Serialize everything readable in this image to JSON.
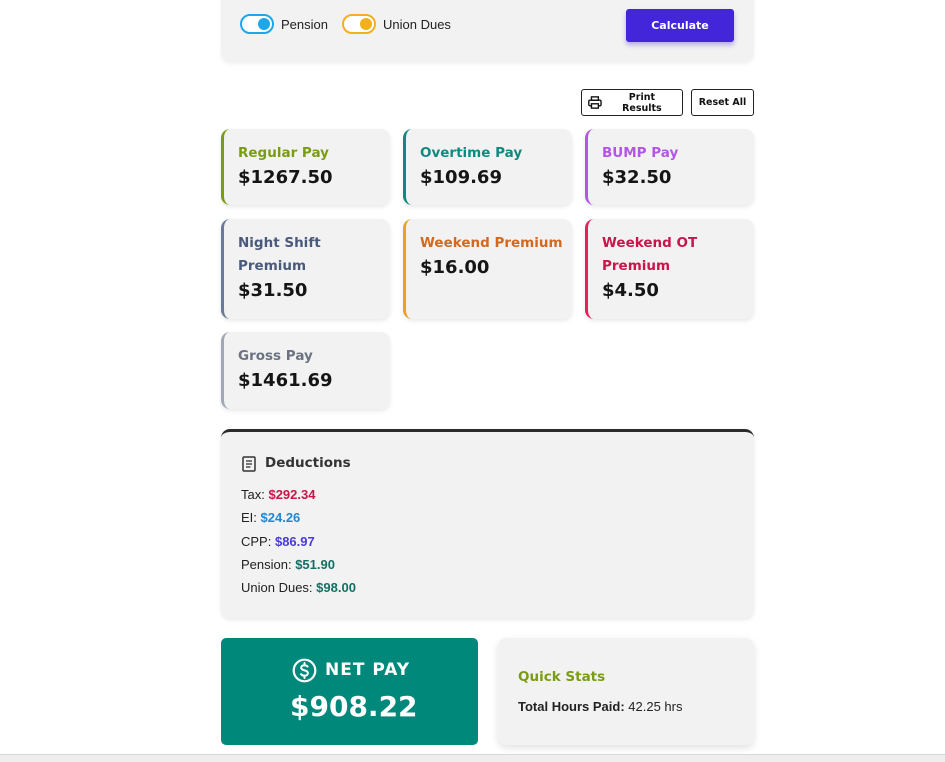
{
  "options": {
    "pension": {
      "label": "Pension",
      "color": "#1ea7e8",
      "on": true
    },
    "union_dues": {
      "label": "Union Dues",
      "color": "#f2b01e",
      "on": true
    }
  },
  "actions": {
    "calculate": "Calculate",
    "print": "Print Results",
    "reset": "Reset All"
  },
  "results": [
    {
      "label": "Regular Pay",
      "value": "$1267.50",
      "color": "#7a9c14"
    },
    {
      "label": "Overtime Pay",
      "value": "$109.69",
      "color": "#0f8a80"
    },
    {
      "label": "BUMP Pay",
      "value": "$32.50",
      "color": "#b455e8"
    },
    {
      "label": "Night Shift Premium",
      "value": "$31.50",
      "color": "#4a5a7a",
      "border": "#6a7a9a"
    },
    {
      "label": "Weekend Premium",
      "value": "$16.00",
      "color": "#d2691e",
      "border": "#f0a020"
    },
    {
      "label": "Weekend OT Premium",
      "value": "$4.50",
      "color": "#c8154a",
      "border": "#e8205a"
    },
    {
      "label": "Gross Pay",
      "value": "$1461.69",
      "color": "#6b7280",
      "border": "#a0a8b8"
    }
  ],
  "deductions": {
    "title": "Deductions",
    "items": [
      {
        "label": "Tax: ",
        "amount": "$292.34",
        "color": "#c8154a"
      },
      {
        "label": "EI: ",
        "amount": "$24.26",
        "color": "#1e88d8"
      },
      {
        "label": "CPP: ",
        "amount": "$86.97",
        "color": "#4a3ad8"
      },
      {
        "label": "Pension: ",
        "amount": "$51.90",
        "color": "#136f63"
      },
      {
        "label": "Union Dues: ",
        "amount": "$98.00",
        "color": "#136f63"
      }
    ]
  },
  "net_pay": {
    "label": "NET PAY",
    "value": "$908.22",
    "color": "#00897b",
    "icon": "dollar-circle-icon"
  },
  "quick_stats": {
    "title": "Quick Stats",
    "total_hours_label": "Total Hours Paid:",
    "total_hours_value": " 42.25 hrs"
  }
}
